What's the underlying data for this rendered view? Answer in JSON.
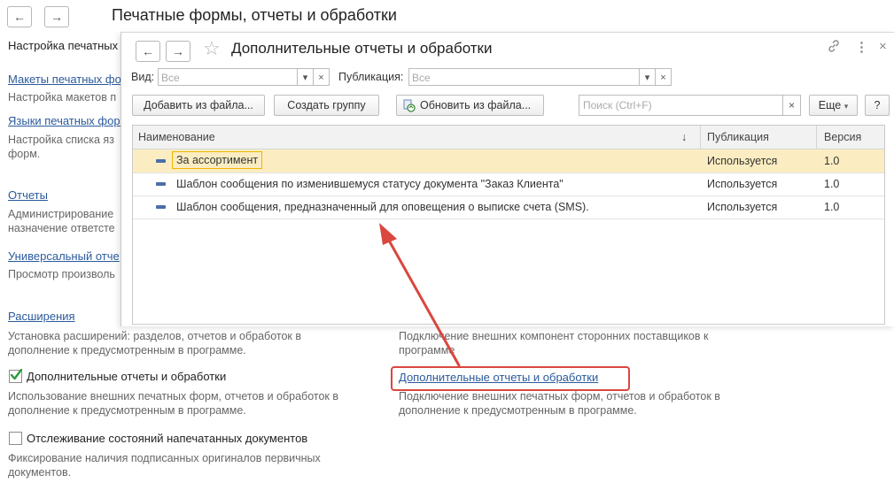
{
  "page": {
    "title": "Печатные формы, отчеты и обработки",
    "nav_back": "←",
    "nav_forward": "→",
    "left_items": [
      {
        "text": "Настройка печатных"
      },
      {
        "link": "Макеты печатных фо",
        "desc": "Настройка макетов п"
      },
      {
        "link": "Языки печатных форм",
        "desc": "Настройка списка яз\nформ."
      },
      {
        "link": "Отчеты",
        "desc": "Администрирование\nназначение ответсте"
      },
      {
        "link": "Универсальный отче",
        "desc": "Просмотр произволь"
      }
    ],
    "extensions": {
      "link": "Расширения",
      "desc": "Установка расширений: разделов, отчетов и обработок в\nдополнение к предусмотренным в программе."
    },
    "external_components_desc": "Подключение внешних компонент сторонних поставщиков к\nпрограмме",
    "additional": {
      "checkbox_label": "Дополнительные отчеты и обработки",
      "checked": true,
      "desc": "Использование внешних печатных форм, отчетов и обработок в\nдополнение к предусмотренным в программе.",
      "link": "Дополнительные отчеты и обработки",
      "link_desc": "Подключение внешних печатных форм, отчетов и обработок в\nдополнение к предусмотренным в программе."
    },
    "tracking": {
      "checkbox_label": "Отслеживание состояний напечатанных документов",
      "checked": false,
      "desc": "Фиксирование наличия подписанных оригиналов первичных\nдокументов."
    }
  },
  "dialog": {
    "title": "Дополнительные отчеты и обработки",
    "star": "☆",
    "link_icon": "🔗",
    "more_icon": "⋮",
    "close_icon": "×",
    "filters": {
      "view_label": "Вид:",
      "view_value": "Все",
      "publication_label": "Публикация:",
      "publication_value": "Все",
      "dropdown_glyph": "▾",
      "clear_glyph": "×"
    },
    "toolbar": {
      "add_from_file": "Добавить из файла...",
      "create_group": "Создать группу",
      "update_from_file": "Обновить из файла...",
      "search_placeholder": "Поиск (Ctrl+F)",
      "search_clear": "×",
      "more": "Еще",
      "more_arrow": "▾",
      "help": "?"
    },
    "table": {
      "columns": [
        "Наименование",
        "Публикация",
        "Версия"
      ],
      "sort_indicator": "↓",
      "rows": [
        {
          "name": "За ассортимент",
          "publication": "Используется",
          "version": "1.0",
          "selected": true
        },
        {
          "name": "Шаблон сообщения по изменившемуся статусу документа \"Заказ Клиента\"",
          "publication": "Используется",
          "version": "1.0",
          "selected": false
        },
        {
          "name": "Шаблон сообщения, предназначенный для оповещения о выписке счета (SMS).",
          "publication": "Используется",
          "version": "1.0",
          "selected": false
        }
      ]
    }
  },
  "annotation": {
    "color": "#d9473f"
  }
}
